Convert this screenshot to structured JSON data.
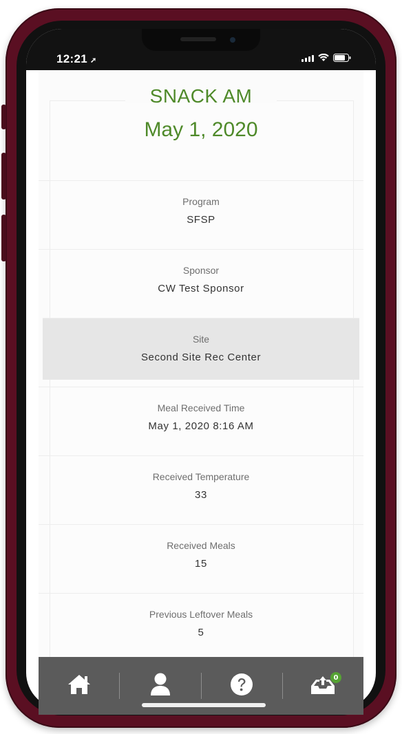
{
  "status_bar": {
    "time": "12:21",
    "location_icon": "location-arrow-icon",
    "signal_icon": "cell-signal-icon",
    "wifi_icon": "wifi-icon",
    "battery_icon": "battery-icon"
  },
  "header": {
    "title": "SNACK AM",
    "date": "May 1, 2020",
    "color": "#4f8a2a"
  },
  "fields": [
    {
      "label": "Program",
      "value": "SFSP"
    },
    {
      "label": "Sponsor",
      "value": "CW Test Sponsor"
    },
    {
      "label": "Site",
      "value": "Second Site Rec Center"
    },
    {
      "label": "Meal Received Time",
      "value": "May 1, 2020 8:16 AM"
    },
    {
      "label": "Received Temperature",
      "value": "33"
    },
    {
      "label": "Received Meals",
      "value": "15"
    },
    {
      "label": "Previous Leftover Meals",
      "value": "5"
    }
  ],
  "tab_bar": {
    "tabs": [
      {
        "name": "home",
        "icon": "home-icon"
      },
      {
        "name": "profile",
        "icon": "user-icon"
      },
      {
        "name": "help",
        "icon": "help-icon"
      },
      {
        "name": "inbox",
        "icon": "inbox-upload-icon",
        "badge": "0"
      }
    ],
    "badge_color": "#56a334"
  }
}
